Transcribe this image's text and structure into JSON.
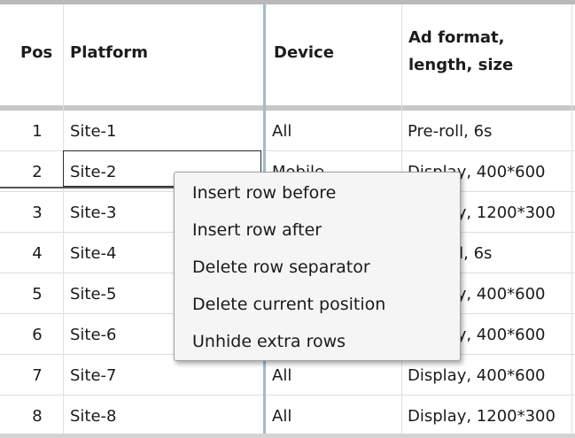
{
  "table": {
    "headers": {
      "pos": "Pos",
      "platform": "Platform",
      "device": "Device",
      "format_line1": "Ad format,",
      "format_line2": "length, size"
    },
    "rows": [
      {
        "pos": "1",
        "platform": "Site-1",
        "device": "All",
        "format": "Pre-roll, 6s"
      },
      {
        "pos": "2",
        "platform": "Site-2",
        "device": "Mobile",
        "format": "Display, 400*600"
      },
      {
        "pos": "3",
        "platform": "Site-3",
        "device": "",
        "format": "Display, 1200*300"
      },
      {
        "pos": "4",
        "platform": "Site-4",
        "device": "",
        "format": "Pre-roll, 6s"
      },
      {
        "pos": "5",
        "platform": "Site-5",
        "device": "",
        "format": "Display, 400*600"
      },
      {
        "pos": "6",
        "platform": "Site-6",
        "device": "",
        "format": "Display, 400*600"
      },
      {
        "pos": "7",
        "platform": "Site-7",
        "device": "All",
        "format": "Display, 400*600"
      },
      {
        "pos": "8",
        "platform": "Site-8",
        "device": "All",
        "format": "Display, 1200*300"
      }
    ]
  },
  "context_menu": {
    "items": [
      {
        "label": "Insert row before"
      },
      {
        "label": "Insert row after"
      },
      {
        "label": "Delete row separator"
      },
      {
        "label": "Delete current position"
      },
      {
        "label": "Unhide extra rows"
      }
    ]
  }
}
